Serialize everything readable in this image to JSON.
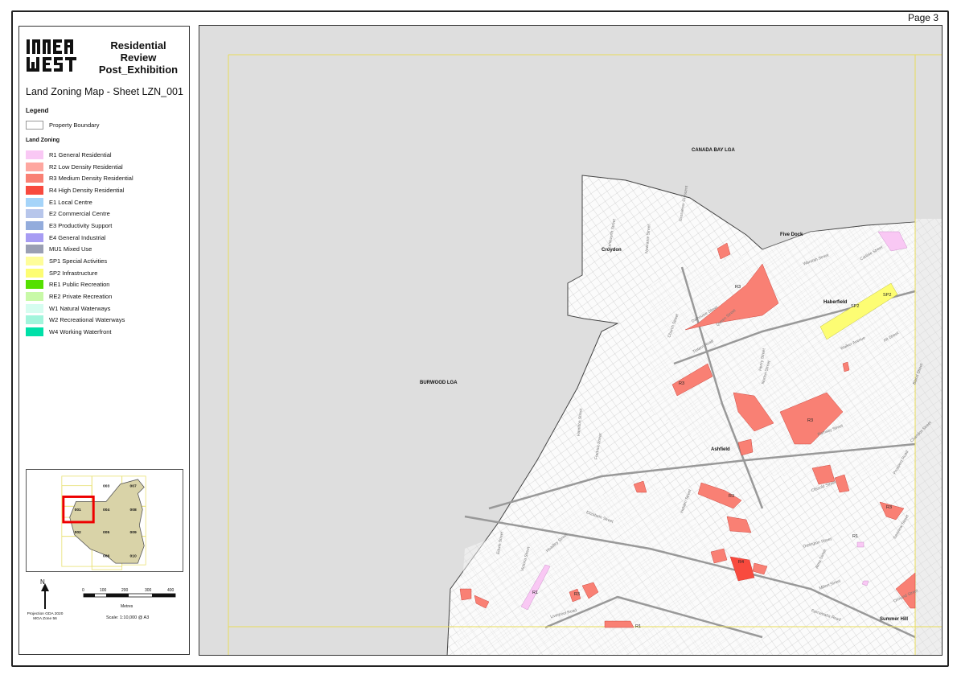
{
  "page": {
    "number_label": "Page 3"
  },
  "logo": {
    "text_line1": "INNER",
    "text_line2": "WEST"
  },
  "header": {
    "title_line1": "Residential",
    "title_line2": "Review",
    "title_line3": "Post_Exhibition",
    "sheet_title": "Land Zoning Map - Sheet LZN_001"
  },
  "legend": {
    "heading": "Legend",
    "property_boundary": "Property Boundary",
    "zoning_heading": "Land Zoning",
    "zones": [
      {
        "label": "R1 General Residential",
        "color": "#f9c8f4"
      },
      {
        "label": "R2 Low Density Residential",
        "color": "#fea7a0"
      },
      {
        "label": "R3 Medium Density Residential",
        "color": "#f98074"
      },
      {
        "label": "R4 High Density Residential",
        "color": "#f84a3e"
      },
      {
        "label": "E1 Local Centre",
        "color": "#a5d4f9"
      },
      {
        "label": "E2 Commercial Centre",
        "color": "#b7c6eb"
      },
      {
        "label": "E3 Productivity Support",
        "color": "#93acdc"
      },
      {
        "label": "E4 General Industrial",
        "color": "#a79cf3"
      },
      {
        "label": "MU1 Mixed Use",
        "color": "#9a9fb3"
      },
      {
        "label": "SP1 Special Activities",
        "color": "#fefd9a"
      },
      {
        "label": "SP2 Infrastructure",
        "color": "#fdfd73"
      },
      {
        "label": "RE1 Public Recreation",
        "color": "#55e000"
      },
      {
        "label": "RE2 Private Recreation",
        "color": "#c8f9a7"
      },
      {
        "label": "W1 Natural Waterways",
        "color": "#d6fdf0"
      },
      {
        "label": "W2 Recreational Waterways",
        "color": "#a2f5dc"
      },
      {
        "label": "W4 Working Waterfront",
        "color": "#00e0a8"
      }
    ]
  },
  "key_map": {
    "tiles": [
      "003",
      "007",
      "001",
      "004",
      "008",
      "002",
      "005",
      "009",
      "006",
      "010"
    ]
  },
  "north": {
    "label": "N"
  },
  "projection": {
    "line1": "Projection GDA 2020",
    "line2": "MGA Zone 56"
  },
  "scale": {
    "ticks": [
      "0",
      "100",
      "200",
      "300",
      "400"
    ],
    "unit": "Metres",
    "text": "Scale: 1:10,000 @ A3"
  },
  "map": {
    "place_labels": {
      "canada_bay": "CANADA BAY LGA",
      "burwood": "BURWOOD LGA",
      "five_dock": "Five Dock",
      "croydon": "Croydon",
      "haberfield": "Haberfield",
      "ashfield": "Ashfield",
      "summer_hill": "Summer Hill"
    },
    "zone_tags": [
      "R3",
      "R3",
      "R3",
      "R3",
      "R4",
      "R3",
      "R1",
      "R1",
      "R1",
      "SP2",
      "SP2",
      "R3"
    ],
    "streets": [
      "Edwin Street",
      "Victoria Street",
      "Hamilton Street",
      "Fredrick Street",
      "Elizabeth Street",
      "Liverpool Road",
      "Church Street",
      "Norton Street",
      "Holden Street",
      "Parramatta Road",
      "Dalhousie Street",
      "Ramsay Street",
      "Waratah Street",
      "Clissold Street",
      "Orpington Street",
      "Prospect Road",
      "Bland Street",
      "Chandos Street",
      "Carlisle Street",
      "Walker Avenue",
      "Alt Street",
      "Seaview Street",
      "Ormond Street",
      "Milton Street",
      "Henry Street",
      "Kenilworth Street",
      "Tintern Road",
      "Nowranie Street",
      "Grosvenor Crescent",
      "Alma Street",
      "Queen Street",
      "Hoadley Street"
    ]
  }
}
